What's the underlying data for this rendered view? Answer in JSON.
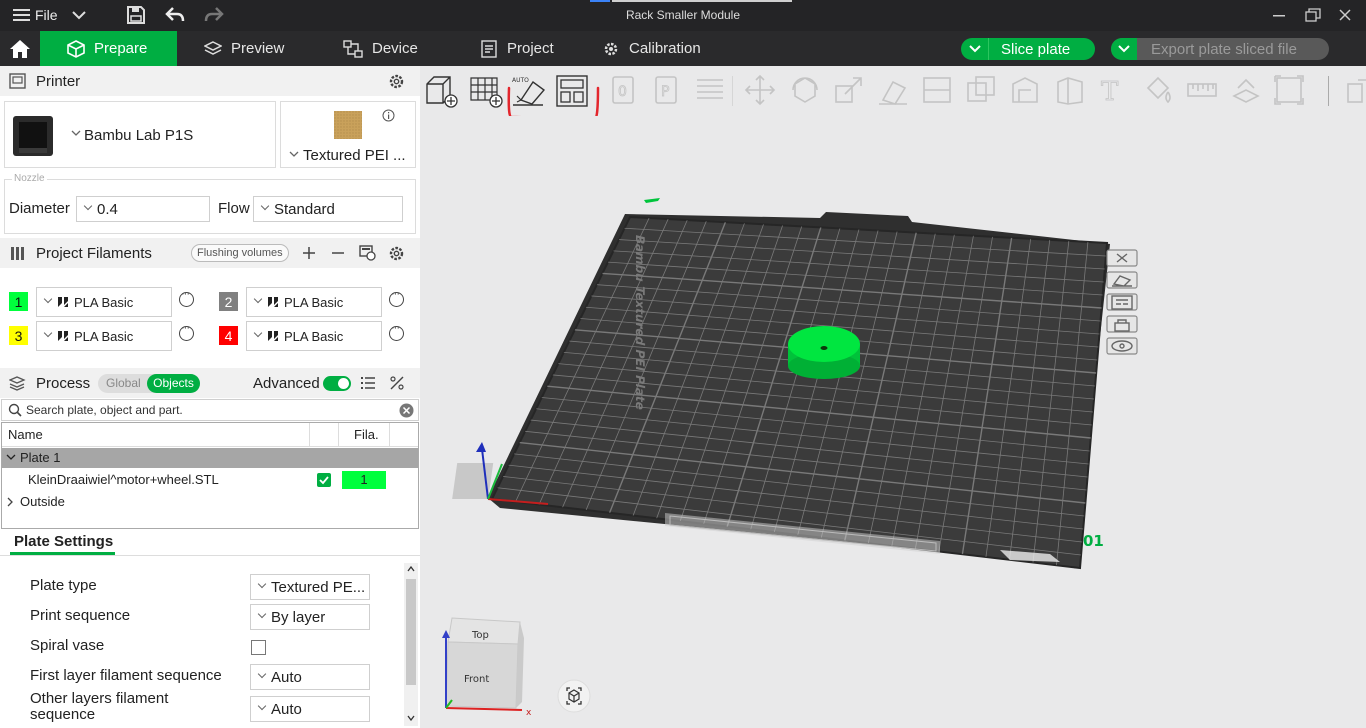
{
  "titlebar": {
    "file_label": "File",
    "app_title": "Rack Smaller Module"
  },
  "menubar": {
    "tabs": [
      {
        "label": "Prepare",
        "active": true
      },
      {
        "label": "Preview"
      },
      {
        "label": "Device"
      },
      {
        "label": "Project"
      },
      {
        "label": "Calibration"
      }
    ],
    "slice_label": "Slice plate",
    "export_label": "Export plate sliced file"
  },
  "printer": {
    "section_label": "Printer",
    "model": "Bambu Lab P1S",
    "plate": "Textured PEI ...",
    "nozzle_label": "Nozzle",
    "diameter_label": "Diameter",
    "diameter_value": "0.4",
    "flow_label": "Flow",
    "flow_value": "Standard"
  },
  "filaments": {
    "section_label": "Project Filaments",
    "flushing_label": "Flushing volumes",
    "items": [
      {
        "num": "1",
        "color": "#00ff3c",
        "text_color": "#111",
        "name": "PLA Basic"
      },
      {
        "num": "2",
        "color": "#808080",
        "text_color": "#fff",
        "name": "PLA Basic"
      },
      {
        "num": "3",
        "color": "#ffff00",
        "text_color": "#111",
        "name": "PLA Basic"
      },
      {
        "num": "4",
        "color": "#ff0000",
        "text_color": "#fff",
        "name": "PLA Basic"
      }
    ]
  },
  "process": {
    "section_label": "Process",
    "global_label": "Global",
    "objects_label": "Objects",
    "advanced_label": "Advanced",
    "search_placeholder": "Search plate, object and part."
  },
  "objects": {
    "col_name": "Name",
    "col_fila": "Fila.",
    "plate_label": "Plate 1",
    "object_name": "KleinDraaiwiel^motor+wheel.STL",
    "object_fila": "1",
    "outside_label": "Outside"
  },
  "plate_settings": {
    "tab_label": "Plate Settings",
    "rows": [
      {
        "label": "Plate type",
        "value": "Textured PE..."
      },
      {
        "label": "Print sequence",
        "value": "By layer"
      },
      {
        "label": "Spiral vase",
        "value": ""
      },
      {
        "label": "First layer filament sequence",
        "value": "Auto"
      },
      {
        "label": "Other layers filament sequence",
        "value": "Auto"
      }
    ]
  },
  "viewport": {
    "plate_number": "01",
    "plate_brand": "Bambu Textured PEI Plate",
    "cube_top": "Top",
    "cube_front": "Front",
    "axis_x": "x",
    "axis_auto": "AUTO"
  },
  "colors": {
    "accent": "#00ae42",
    "annotation": "#e3262d",
    "object": "#00e640"
  }
}
